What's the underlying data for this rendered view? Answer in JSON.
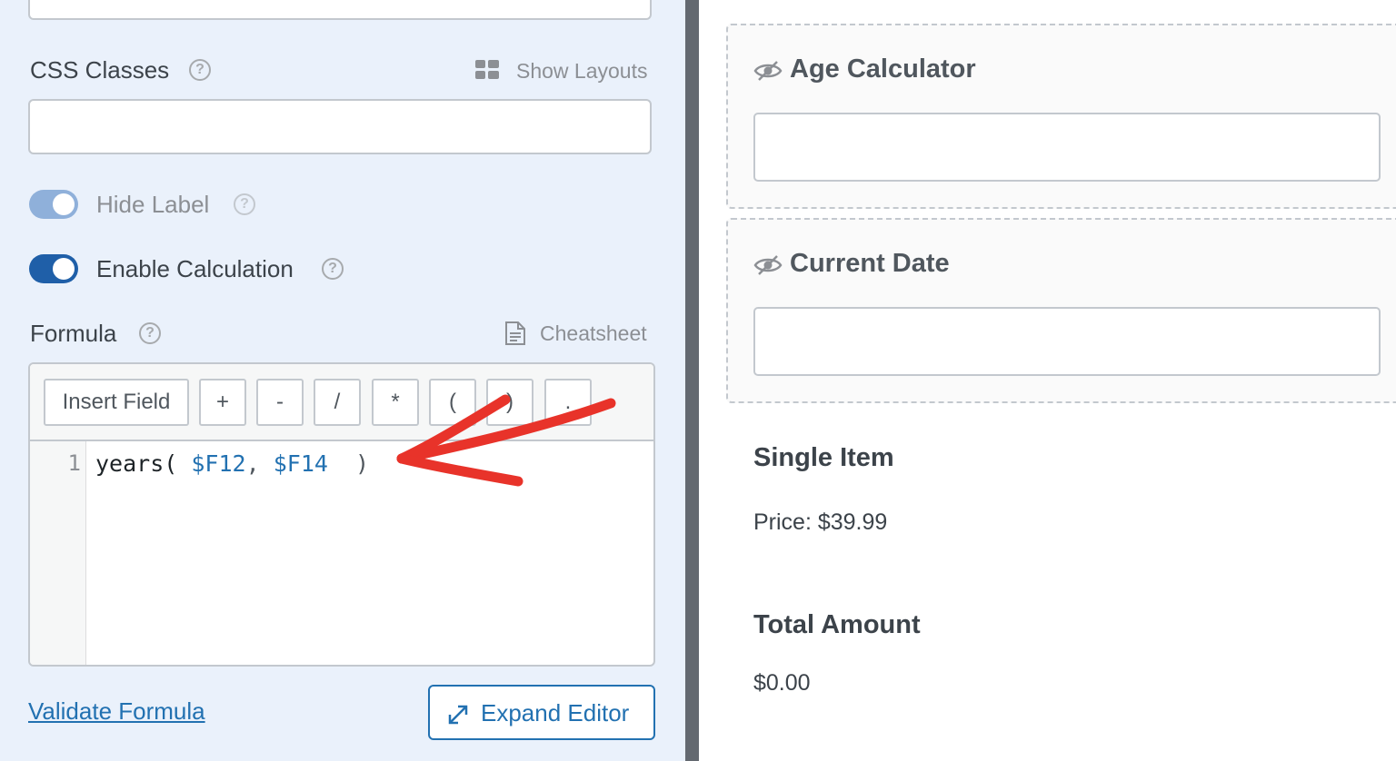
{
  "settings": {
    "css_classes": {
      "label": "CSS Classes",
      "help": "?",
      "show_layouts_label": "Show Layouts",
      "value": ""
    },
    "hide_label": {
      "label": "Hide Label",
      "help": "?",
      "enabled": true,
      "disabled_style": true
    },
    "enable_calculation": {
      "label": "Enable Calculation",
      "help": "?",
      "enabled": true
    },
    "formula": {
      "label": "Formula",
      "help": "?",
      "cheatsheet_label": "Cheatsheet",
      "toolbar": {
        "insert_field": "Insert Field",
        "plus": "+",
        "minus": "-",
        "divide": "/",
        "multiply": "*",
        "open_paren": "(",
        "close_paren": ")",
        "dot": "."
      },
      "line_number": "1",
      "code": {
        "fn": "years(",
        "arg1": "$F12",
        "comma": ",",
        "arg2": "$F14",
        "close": ")"
      }
    },
    "validate_label": "Validate Formula",
    "expand_label": "Expand Editor"
  },
  "preview": {
    "age_calculator": {
      "title": "Age Calculator",
      "value": ""
    },
    "current_date": {
      "title": "Current Date",
      "value": ""
    },
    "single_item": {
      "title": "Single Item",
      "price_text": "Price: $39.99"
    },
    "total_amount": {
      "title": "Total Amount",
      "value": "$0.00"
    }
  },
  "colors": {
    "panel_bg": "#eaf1fb",
    "divider": "#646970",
    "accent": "#2271b1",
    "toggle_on": "#1f5fa8",
    "annotation_arrow": "#e8332a"
  }
}
